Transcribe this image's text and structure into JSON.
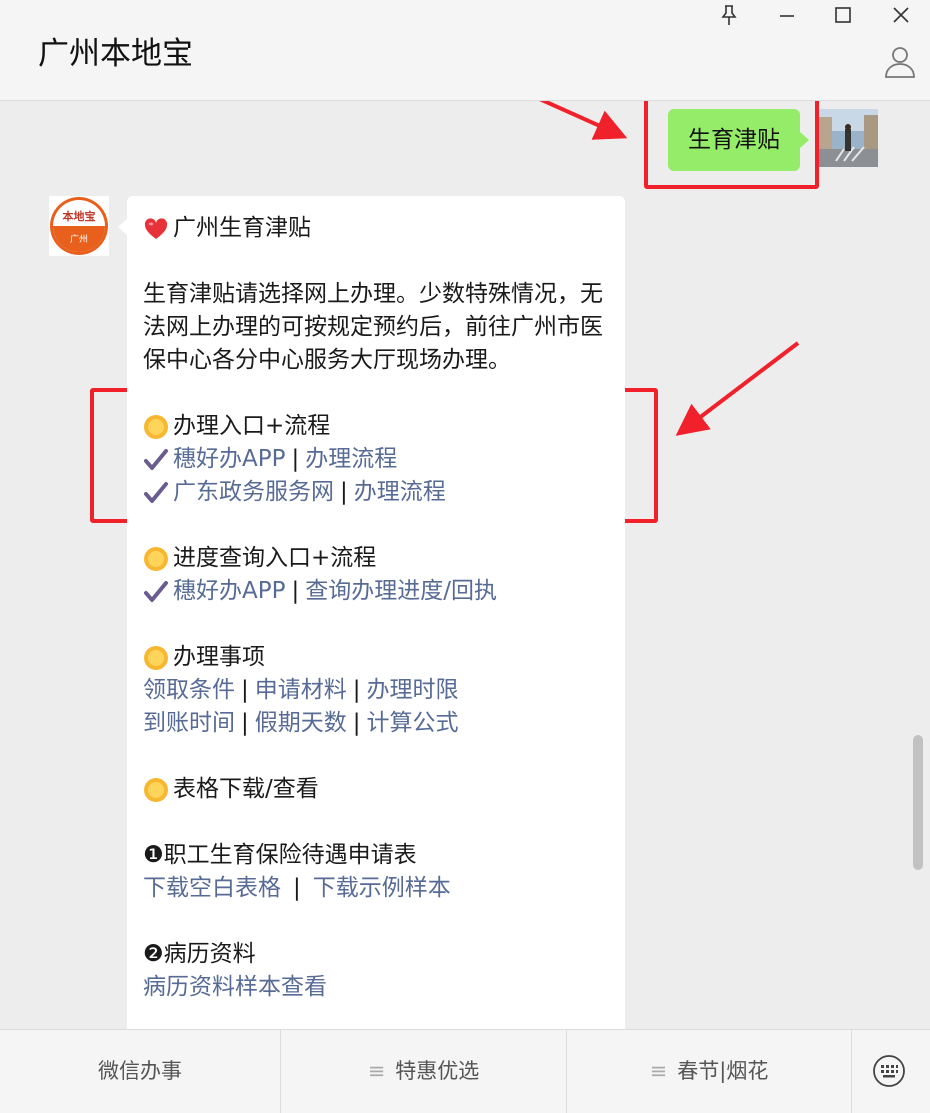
{
  "window": {
    "title": "广州本地宝",
    "controls": {
      "pin": "pin-icon",
      "minimize": "minimize-icon",
      "maximize": "maximize-icon",
      "close": "close-icon"
    }
  },
  "chat": {
    "sent_message": "生育津贴",
    "bot_avatar": {
      "line1": "本地宝",
      "line2": "广州"
    },
    "reply": {
      "title": "广州生育津贴",
      "intro": "生育津贴请选择网上办理。少数特殊情况，无法网上办理的可按规定预约后，前往广州市医保中心各分中心服务大厅现场办理。",
      "sec1": {
        "heading": "办理入口+流程",
        "row1": {
          "a": "穗好办APP",
          "sep": "|",
          "b": "办理流程"
        },
        "row2": {
          "a": "广东政务服务网",
          "sep": "|",
          "b": "办理流程"
        }
      },
      "sec2": {
        "heading": "进度查询入口+流程",
        "row1": {
          "a": "穗好办APP",
          "sep": "|",
          "b": "查询办理进度/回执"
        }
      },
      "sec3": {
        "heading": "办理事项",
        "row1": {
          "a": "领取条件",
          "s1": "|",
          "b": "申请材料",
          "s2": "|",
          "c": "办理时限"
        },
        "row2": {
          "a": "到账时间",
          "s1": "|",
          "b": "假期天数",
          "s2": "|",
          "c": "计算公式"
        }
      },
      "sec4": {
        "heading": "表格下载/查看"
      },
      "item1": {
        "title": "❶职工生育保险待遇申请表",
        "a": "下载空白表格",
        "sep": "|",
        "b": "下载示例样本"
      },
      "item2": {
        "title": "❷病历资料",
        "a": "病历资料样本查看"
      }
    }
  },
  "footer": {
    "menu1": "微信办事",
    "menu2": "特惠优选",
    "menu3": "春节|烟花",
    "menu_icon": "≡",
    "keyboard": "keyboard-icon"
  },
  "colors": {
    "link": "#576b95",
    "sent_bubble": "#95ec69",
    "annotation": "#f0212a"
  }
}
